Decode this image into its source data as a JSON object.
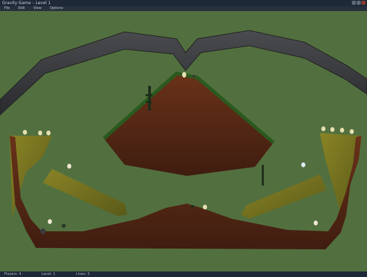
{
  "window": {
    "title": "Gravity Game – Level 1"
  },
  "menu": [
    {
      "label": "File"
    },
    {
      "label": "Edit"
    },
    {
      "label": "View"
    },
    {
      "label": "Options"
    }
  ],
  "status": {
    "left": "Players: 4",
    "center": "Level: 1",
    "right": "Lives: 3"
  },
  "colors": {
    "sky": "#52703f",
    "dirt": "#5a2a17",
    "grass": "#2a5a1e",
    "moss": "#7a7620",
    "rock": "#3c3d40"
  },
  "icons": [
    "minimize-icon",
    "maximize-icon",
    "close-icon",
    "egg-icon",
    "tree-icon",
    "rock-icon"
  ]
}
